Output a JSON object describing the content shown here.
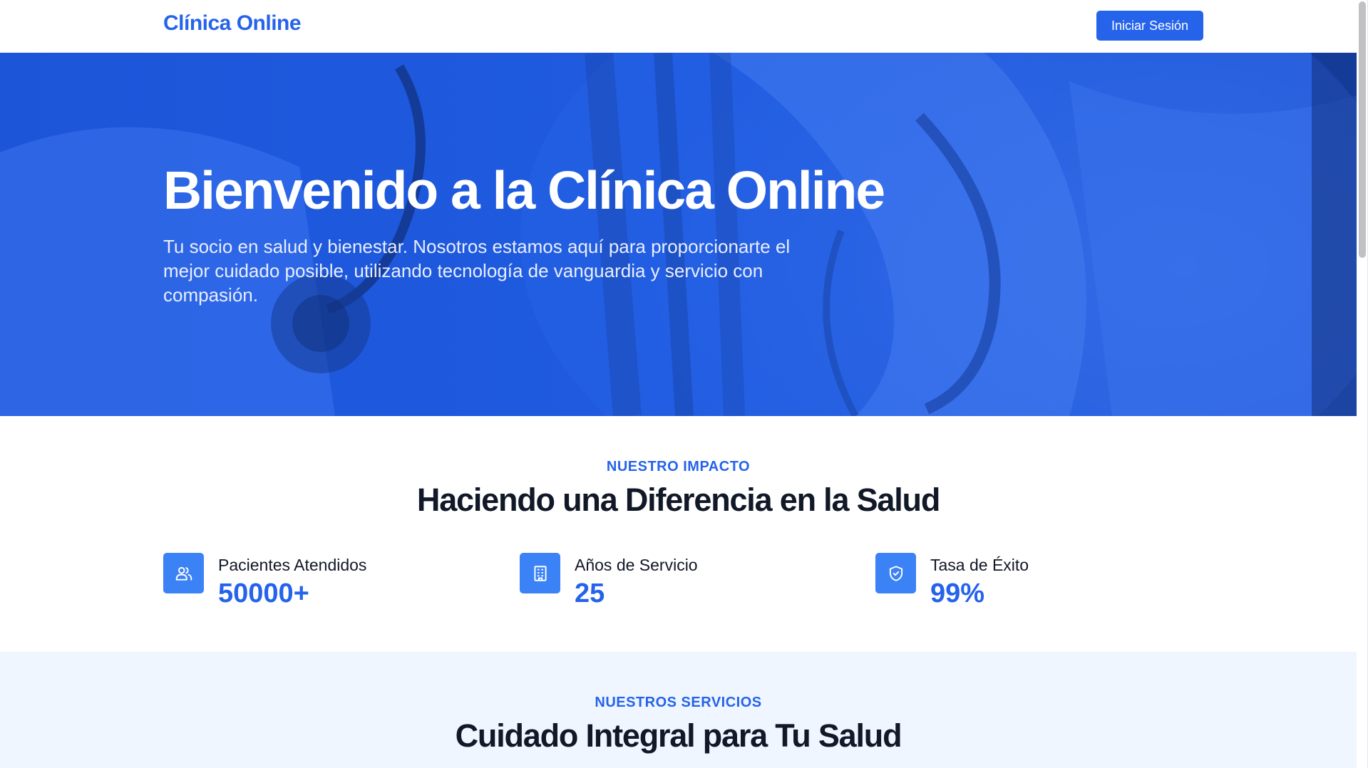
{
  "header": {
    "brand": "Clínica Online",
    "login_label": "Iniciar Sesión"
  },
  "hero": {
    "title": "Bienvenido a la Clínica Online",
    "subtitle": "Tu socio en salud y bienestar. Nosotros estamos aquí para proporcionarte el mejor cuidado posible, utilizando tecnología de vanguardia y servicio con compasión."
  },
  "impact": {
    "eyebrow": "NUESTRO IMPACTO",
    "title": "Haciendo una Diferencia en la Salud",
    "stats": [
      {
        "icon": "users-icon",
        "label": "Pacientes Atendidos",
        "value": "50000+"
      },
      {
        "icon": "building-icon",
        "label": "Años de Servicio",
        "value": "25"
      },
      {
        "icon": "shield-check-icon",
        "label": "Tasa de Éxito",
        "value": "99%"
      }
    ]
  },
  "services": {
    "eyebrow": "NUESTROS SERVICIOS",
    "title": "Cuidado Integral para Tu Salud"
  },
  "colors": {
    "primary": "#2563eb",
    "icon_bg": "#3b82f6",
    "services_bg": "#eff6ff",
    "text_dark": "#111827"
  }
}
